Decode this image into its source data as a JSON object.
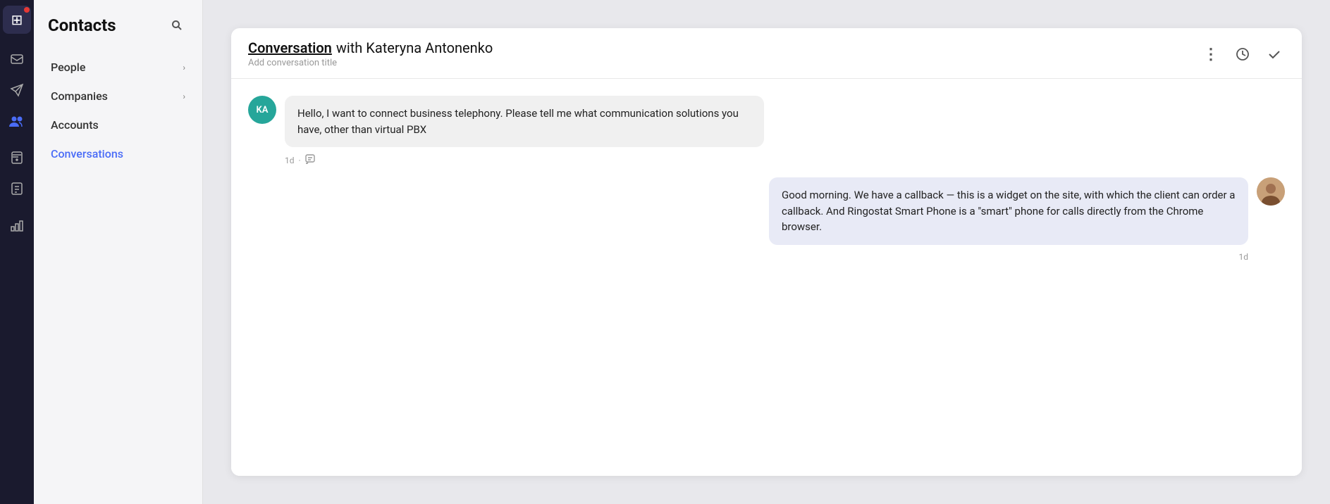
{
  "app": {
    "title": "Contacts",
    "search_button_label": "Search"
  },
  "rail": {
    "logo_icon": "grid-icon",
    "icons": [
      {
        "name": "inbox-icon",
        "symbol": "✉",
        "active": false
      },
      {
        "name": "send-icon",
        "symbol": "✈",
        "active": false
      },
      {
        "name": "contacts-icon",
        "symbol": "👥",
        "active": true
      },
      {
        "name": "knowledge-icon",
        "symbol": "📖",
        "active": false
      },
      {
        "name": "notes-icon",
        "symbol": "🗒",
        "active": false
      },
      {
        "name": "analytics-icon",
        "symbol": "📊",
        "active": false
      }
    ]
  },
  "sidebar": {
    "title": "Contacts",
    "nav_items": [
      {
        "label": "People",
        "has_chevron": true,
        "active": false
      },
      {
        "label": "Companies",
        "has_chevron": true,
        "active": false
      },
      {
        "label": "Accounts",
        "has_chevron": false,
        "active": false
      },
      {
        "label": "Conversations",
        "has_chevron": false,
        "active": true
      }
    ]
  },
  "conversation": {
    "title_link": "Conversation",
    "title_rest": " with Kateryna Antonenko",
    "subtitle": "Add conversation title",
    "actions": {
      "more_label": "⋮",
      "history_label": "⏱",
      "check_label": "✓"
    },
    "messages": [
      {
        "id": "msg-1",
        "direction": "incoming",
        "avatar_initials": "KA",
        "avatar_color": "#26a69a",
        "text": "Hello, I want to connect business telephony. Please tell me what communication solutions you have, other than virtual PBX",
        "time": "1d",
        "has_note_icon": true
      },
      {
        "id": "msg-2",
        "direction": "outgoing",
        "avatar_type": "photo",
        "text": "Good morning. We have a callback — this is a widget on the site, with which the client can order a callback. And Ringostat Smart Phone is a \"smart\" phone for calls directly from the Chrome browser.",
        "time": "1d",
        "has_note_icon": false
      }
    ]
  },
  "icons": {
    "note": "💬",
    "chevron": "›"
  }
}
